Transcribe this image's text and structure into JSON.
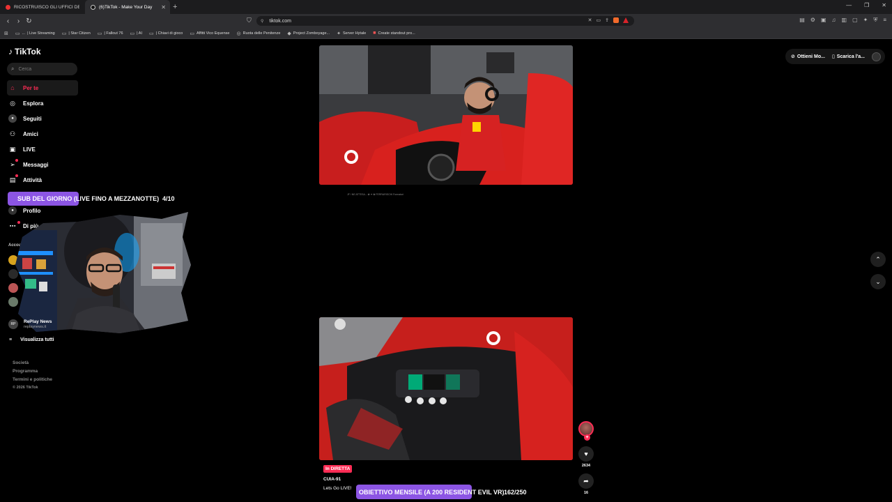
{
  "browser": {
    "tabs": [
      {
        "title": "RICOSTRUISCO GLI UFFICI DEL CAPO",
        "active": false
      },
      {
        "title": "(6)TikTok - Make Your Day",
        "active": true
      }
    ],
    "url": "tiktok.com",
    "bookmarks": [
      "...",
      "| Live Streaming",
      "| Star Citizen",
      "| Fallout 76",
      "| AI",
      "| Chiavi di gioco",
      "Affitti Vico Equense",
      "Ruota delle Penitenze",
      "Project Zomboyage...",
      "Server Hytale",
      "Create standout pro..."
    ]
  },
  "tiktok": {
    "logo_text": "TikTok",
    "search_placeholder": "Cerca",
    "nav": [
      {
        "label": "Per te",
        "icon": "home-icon",
        "active": true
      },
      {
        "label": "Esplora",
        "icon": "compass-icon"
      },
      {
        "label": "Seguiti",
        "icon": "following-icon"
      },
      {
        "label": "Amici",
        "icon": "friends-icon"
      },
      {
        "label": "LIVE",
        "icon": "live-icon"
      },
      {
        "label": "Messaggi",
        "icon": "messages-icon"
      },
      {
        "label": "Attività",
        "icon": "activity-icon"
      },
      {
        "label": "Profilo",
        "icon": "profile-icon"
      },
      {
        "label": "Di più",
        "icon": "more-icon"
      }
    ],
    "accounts_label": "Account",
    "replay": {
      "name": "RePlay News",
      "handle": "replaynews.it"
    },
    "view_all": "Visualizza tutti",
    "footer": [
      "Società",
      "Programma",
      "Termini e politiche"
    ],
    "copyright": "© 2026 TikTok",
    "topright": {
      "get_coins": "Ottieni Mo...",
      "download": "Scarica l'a..."
    },
    "caption_first": "JF / NE ATTESA... ✿ ✦ ✿ FERRARISCHI Formatori",
    "live_badge": "In DIRETTA",
    "video_user": "CUIA-91",
    "video_desc": "Lets Go LIVE!",
    "likes": "2634",
    "shares": "16"
  },
  "overlays": {
    "sub_banner": "SUB DEL GIORNO (LIVE FINO A MEZZANOTTE)",
    "sub_count": "4/10",
    "obj_banner": "OBIETTIVO MENSILE (A 200 RESIDENT EVIL VR)",
    "obj_count": "162/250"
  },
  "colors": {
    "accent": "#fe2c55",
    "overlay_purple": "#8c55e4",
    "ferrari_red": "#d8211e"
  }
}
